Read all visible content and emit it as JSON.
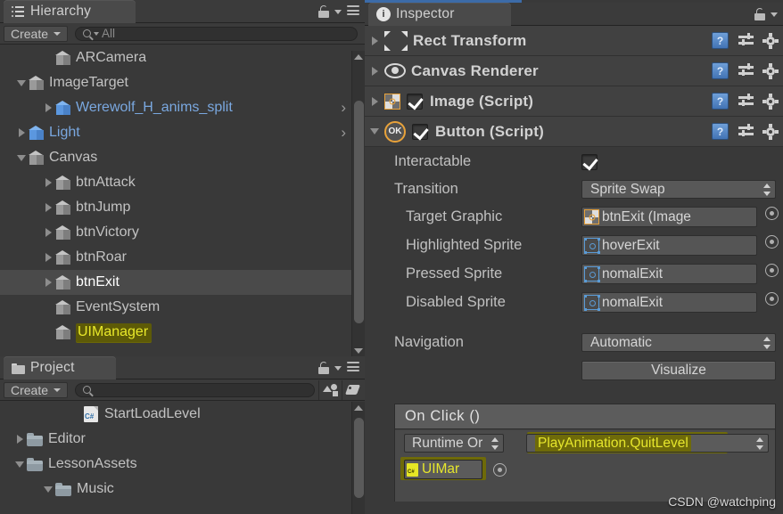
{
  "hierarchy": {
    "tab_label": "Hierarchy",
    "tab_icon": "hierarchy-list-icon",
    "create_label": "Create",
    "search_placeholder": "All",
    "items": [
      {
        "label": "ARCamera",
        "depth": 1,
        "twist": "none",
        "icon": "cube",
        "blue": false,
        "selected": false,
        "chevron": false,
        "highlight": false
      },
      {
        "label": "ImageTarget",
        "depth": 0,
        "twist": "expanded",
        "icon": "cube",
        "blue": false,
        "selected": false,
        "chevron": false,
        "highlight": false
      },
      {
        "label": "Werewolf_H_anims_split",
        "depth": 1,
        "twist": "collapsed",
        "icon": "cube-blue",
        "blue": true,
        "selected": false,
        "chevron": true,
        "highlight": false
      },
      {
        "label": "Light",
        "depth": 0,
        "twist": "collapsed",
        "icon": "cube-blue",
        "blue": true,
        "selected": false,
        "chevron": true,
        "highlight": false
      },
      {
        "label": "Canvas",
        "depth": 0,
        "twist": "expanded",
        "icon": "cube",
        "blue": false,
        "selected": false,
        "chevron": false,
        "highlight": false
      },
      {
        "label": "btnAttack",
        "depth": 1,
        "twist": "collapsed",
        "icon": "cube",
        "blue": false,
        "selected": false,
        "chevron": false,
        "highlight": false
      },
      {
        "label": "btnJump",
        "depth": 1,
        "twist": "collapsed",
        "icon": "cube",
        "blue": false,
        "selected": false,
        "chevron": false,
        "highlight": false
      },
      {
        "label": "btnVictory",
        "depth": 1,
        "twist": "collapsed",
        "icon": "cube",
        "blue": false,
        "selected": false,
        "chevron": false,
        "highlight": false
      },
      {
        "label": "btnRoar",
        "depth": 1,
        "twist": "collapsed",
        "icon": "cube",
        "blue": false,
        "selected": false,
        "chevron": false,
        "highlight": false
      },
      {
        "label": "btnExit",
        "depth": 1,
        "twist": "collapsed",
        "icon": "cube",
        "blue": false,
        "selected": true,
        "chevron": false,
        "highlight": false
      },
      {
        "label": "EventSystem",
        "depth": 1,
        "twist": "none",
        "icon": "cube",
        "blue": false,
        "selected": false,
        "chevron": false,
        "highlight": false
      },
      {
        "label": "UIManager",
        "depth": 1,
        "twist": "none",
        "icon": "cube",
        "blue": false,
        "selected": false,
        "chevron": false,
        "highlight": true
      }
    ]
  },
  "project": {
    "tab_label": "Project",
    "tab_icon": "folder-icon",
    "create_label": "Create",
    "search_placeholder": "",
    "filter_type_icon": "filter-by-type-icon",
    "filter_label_icon": "filter-by-label-icon",
    "items": [
      {
        "label": "StartLoadLevel",
        "depth": 2,
        "twist": "none",
        "icon": "csharp-script"
      },
      {
        "label": "Editor",
        "depth": 0,
        "twist": "collapsed",
        "icon": "folder"
      },
      {
        "label": "LessonAssets",
        "depth": 0,
        "twist": "expanded",
        "icon": "folder"
      },
      {
        "label": "Music",
        "depth": 1,
        "twist": "expanded",
        "icon": "folder"
      }
    ]
  },
  "inspector": {
    "tab_label": "Inspector",
    "tab_icon": "info-circle-icon",
    "components": [
      {
        "title": "Rect Transform",
        "icon": "rect-transform-icon",
        "twist": "collapsed",
        "checkbox": null
      },
      {
        "title": "Canvas Renderer",
        "icon": "eye-icon",
        "twist": "collapsed",
        "checkbox": null
      },
      {
        "title": "Image (Script)",
        "icon": "image-script-icon",
        "twist": "collapsed",
        "checkbox": true
      },
      {
        "title": "Button (Script)",
        "icon": "ok-circle-icon",
        "twist": "expanded",
        "checkbox": true
      }
    ],
    "row_icons": {
      "help": "help-book-icon",
      "preset": "preset-sliders-icon",
      "settings": "gear-icon"
    },
    "button": {
      "interactable_label": "Interactable",
      "interactable_value": true,
      "transition_label": "Transition",
      "transition_value": "Sprite Swap",
      "fields": [
        {
          "label": "Target Graphic",
          "value": "btnExit (Image",
          "icon": "image-sprite-icon"
        },
        {
          "label": "Highlighted Sprite",
          "value": "hoverExit",
          "icon": "sprite-icon"
        },
        {
          "label": "Pressed Sprite",
          "value": "nomalExit",
          "icon": "sprite-icon"
        },
        {
          "label": "Disabled Sprite",
          "value": "nomalExit",
          "icon": "sprite-icon"
        }
      ],
      "navigation_label": "Navigation",
      "navigation_value": "Automatic",
      "visualize_label": "Visualize",
      "onclick": {
        "title": "On Click ()",
        "runtime_mode": "Runtime Or",
        "function": "PlayAnimation.QuitLevel",
        "object": "UIMar",
        "object_icon": "csharp-script-icon"
      }
    }
  },
  "watermark": "CSDN @watchping",
  "colors": {
    "panel_bg": "#393939",
    "tab_bg": "#4a4a4a",
    "component_row": "#414141",
    "accent_blue": "#3c6ba8",
    "highlight_yellow": "#6e6a09",
    "highlight_text": "#e6e62c",
    "selection": "#4a4a4a",
    "sprite_blue": "#5b9bd5",
    "image_orange": "#e8a23a"
  }
}
